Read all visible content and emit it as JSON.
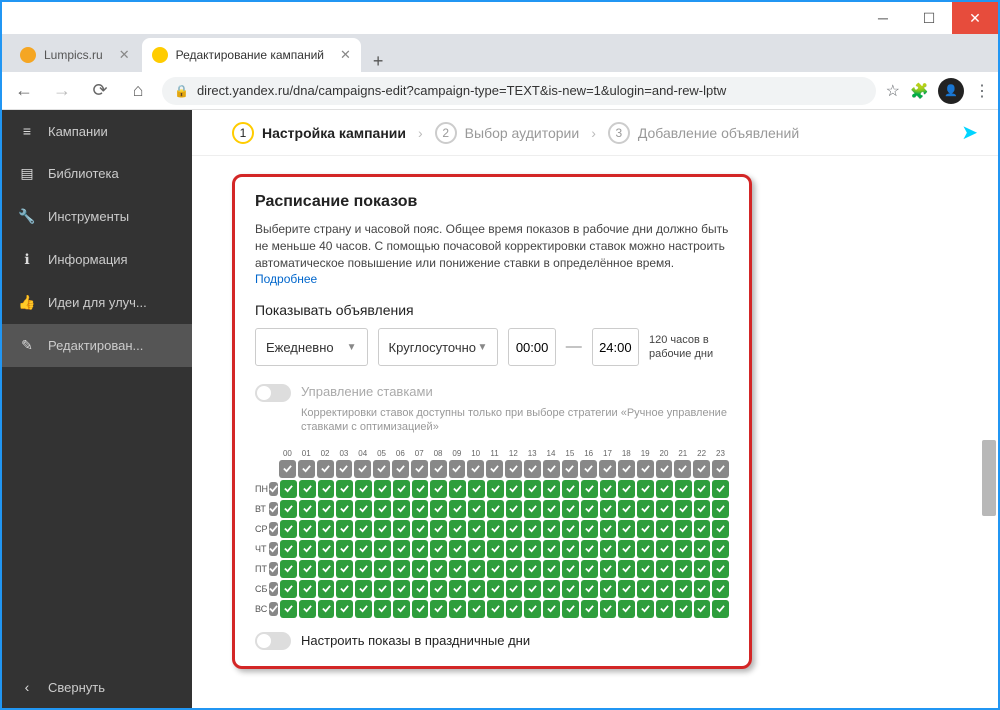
{
  "tabs": [
    {
      "label": "Lumpics.ru",
      "favicon_color": "#f5a623"
    },
    {
      "label": "Редактирование кампаний",
      "favicon_color": "#ffcc00"
    }
  ],
  "url": "direct.yandex.ru/dna/campaigns-edit?campaign-type=TEXT&is-new=1&ulogin=and-rew-lptw",
  "sidebar": {
    "items": [
      {
        "icon": "≡",
        "label": "Кампании"
      },
      {
        "icon": "📚",
        "label": "Библиотека"
      },
      {
        "icon": "🔧",
        "label": "Инструменты"
      },
      {
        "icon": "ℹ",
        "label": "Информация"
      },
      {
        "icon": "👍",
        "label": "Идеи для улуч..."
      },
      {
        "icon": "✎",
        "label": "Редактирован..."
      }
    ],
    "collapse": "Свернуть"
  },
  "stepper": [
    {
      "num": "1",
      "label": "Настройка кампании"
    },
    {
      "num": "2",
      "label": "Выбор аудитории"
    },
    {
      "num": "3",
      "label": "Добавление объявлений"
    }
  ],
  "panel": {
    "title": "Расписание показов",
    "desc": "Выберите страну и часовой пояс. Общее время показов в рабочие дни должно быть не меньше 40 часов. С помощью почасовой корректировки ставок можно настроить автоматическое повышение или понижение ставки в определённое время. ",
    "more": "Подробнее",
    "show_label": "Показывать объявления",
    "freq": "Ежедневно",
    "span": "Круглосуточно",
    "t1": "00:00",
    "t2": "24:00",
    "hours_note": "120 часов в рабочие дни",
    "bid_title": "Управление ставками",
    "bid_sub": "Корректировки ставок доступны только при выборе стратегии «Ручное управление ставками с оптимизацией»",
    "hours": [
      "00",
      "01",
      "02",
      "03",
      "04",
      "05",
      "06",
      "07",
      "08",
      "09",
      "10",
      "11",
      "12",
      "13",
      "14",
      "15",
      "16",
      "17",
      "18",
      "19",
      "20",
      "21",
      "22",
      "23"
    ],
    "days": [
      "ПН",
      "ВТ",
      "СР",
      "ЧТ",
      "ПТ",
      "СБ",
      "ВС"
    ],
    "holiday": "Настроить показы в праздничные дни"
  }
}
